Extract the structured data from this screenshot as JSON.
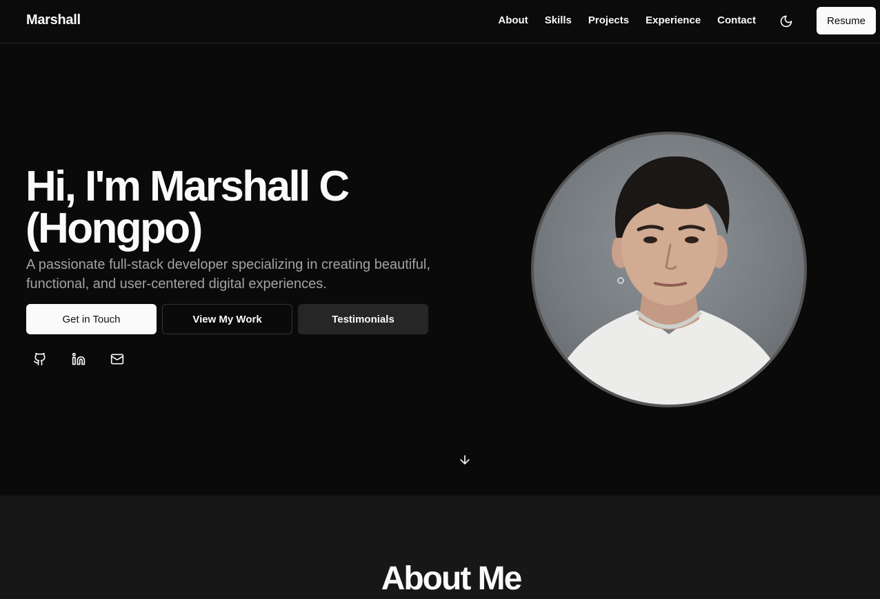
{
  "header": {
    "logo": "Marshall",
    "nav": [
      "About",
      "Skills",
      "Projects",
      "Experience",
      "Contact"
    ],
    "theme_icon": "moon-icon",
    "resume_label": "Resume"
  },
  "hero": {
    "title_line1": "Hi, I'm Marshall C",
    "title_line2": "(Hongpo)",
    "subtitle": "A passionate full-stack developer specializing in creating beautiful, functional, and user-centered digital experiences.",
    "buttons": {
      "touch": "Get in Touch",
      "work": "View My Work",
      "testimonials": "Testimonials"
    },
    "social_icons": [
      "github-icon",
      "linkedin-icon",
      "mail-icon"
    ],
    "scroll_icon": "arrow-down-icon"
  },
  "about": {
    "title": "About Me"
  },
  "colors": {
    "background": "#0a0a0a",
    "section_alt": "#171717",
    "text": "#fafafa",
    "muted": "#a3a3a3",
    "button_dark": "#262626"
  }
}
